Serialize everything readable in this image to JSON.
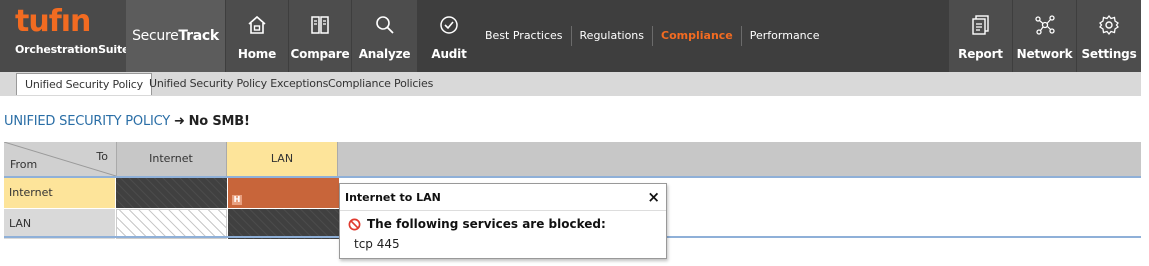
{
  "brand": {
    "logo_word": "tufın",
    "logo_sub_prefix": "Orchestration",
    "logo_sub_suffix": "Suite",
    "product_prefix": "Secure",
    "product_suffix": "Track",
    "accent": "#f26b21"
  },
  "nav": {
    "left": [
      {
        "label": "Home",
        "icon": "home-icon"
      },
      {
        "label": "Compare",
        "icon": "compare-icon"
      },
      {
        "label": "Analyze",
        "icon": "search-icon"
      },
      {
        "label": "Audit",
        "icon": "check-circle-icon"
      }
    ],
    "audit_sublinks": [
      "Best Practices",
      "Regulations",
      "Compliance",
      "Performance"
    ],
    "active_sublink": "Compliance",
    "right": [
      {
        "label": "Report",
        "icon": "report-icon"
      },
      {
        "label": "Network",
        "icon": "network-icon"
      },
      {
        "label": "Settings",
        "icon": "gear-icon"
      }
    ]
  },
  "tabs": {
    "items": [
      "Unified Security Policy",
      "Unified Security Policy Exceptions",
      "Compliance Policies"
    ],
    "active": "Unified Security Policy"
  },
  "heading": {
    "link": "UNIFIED SECURITY POLICY",
    "arrow": "➜",
    "name": "No SMB!"
  },
  "matrix": {
    "corner_to": "To",
    "corner_from": "From",
    "columns": [
      "Internet",
      "LAN"
    ],
    "rows": [
      "Internet",
      "LAN"
    ],
    "highlight": {
      "row": "Internet",
      "column": "LAN"
    },
    "badge": "H",
    "colors": {
      "blocked": "#c8653a",
      "highlight": "#fde49a",
      "self": "#404040"
    }
  },
  "popup": {
    "title": "Internet to LAN",
    "close": "×",
    "message": "The following services are blocked:",
    "services": [
      "tcp 445"
    ],
    "icon": "blocked-icon"
  }
}
